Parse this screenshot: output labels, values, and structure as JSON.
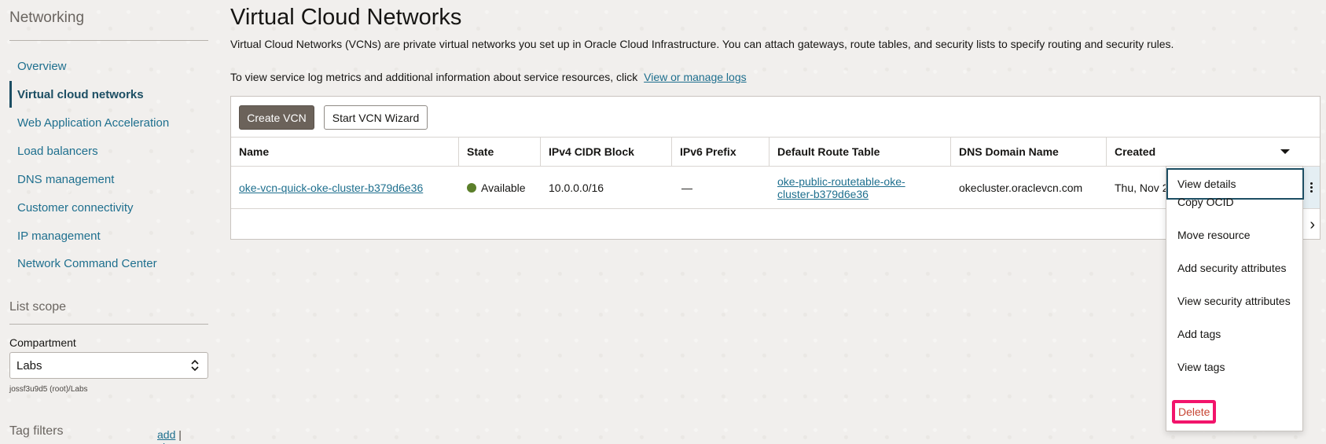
{
  "sidebar": {
    "title": "Networking",
    "items": [
      {
        "label": "Overview"
      },
      {
        "label": "Virtual cloud networks"
      },
      {
        "label": "Web Application Acceleration"
      },
      {
        "label": "Load balancers"
      },
      {
        "label": "DNS management"
      },
      {
        "label": "Customer connectivity"
      },
      {
        "label": "IP management"
      },
      {
        "label": "Network Command Center"
      }
    ],
    "list_scope": "List scope",
    "compartment_label": "Compartment",
    "compartment_value": "Labs",
    "compartment_path": "jossf3u9d5 (root)/Labs",
    "tag_filters": "Tag filters",
    "tag_add": "add",
    "tag_sep": "|",
    "tag_clear": "clear"
  },
  "main": {
    "title": "Virtual Cloud Networks",
    "intro": "Virtual Cloud Networks (VCNs) are private virtual networks you set up in Oracle Cloud Infrastructure. You can attach gateways, route tables, and security lists to specify routing and security rules.",
    "logs_text": "To view service log metrics and additional information about service resources, click",
    "logs_link": "View or manage logs",
    "create_btn": "Create VCN",
    "wizard_btn": "Start VCN Wizard",
    "columns": [
      "Name",
      "State",
      "IPv4 CIDR Block",
      "IPv6 Prefix",
      "Default Route Table",
      "DNS Domain Name",
      "Created"
    ],
    "row": {
      "name": "oke-vcn-quick-oke-cluster-b379d6e36",
      "state": "Available",
      "ipv4": "10.0.0.0/16",
      "ipv6": "—",
      "route_table": "oke-public-routetable-oke-cluster-b379d6e36",
      "dns": "okecluster.oraclevcn.com",
      "created": "Thu, Nov 2"
    }
  },
  "menu": {
    "items": [
      "View details",
      "Copy OCID",
      "Move resource",
      "Add security attributes",
      "View security attributes",
      "Add tags",
      "View tags",
      "Delete"
    ]
  },
  "colors": {
    "accent": "#1e6f8e",
    "primary_button": "#6b625a",
    "state_available": "#5b7f2a",
    "delete": "#c74634",
    "highlight": "#f2146b"
  }
}
